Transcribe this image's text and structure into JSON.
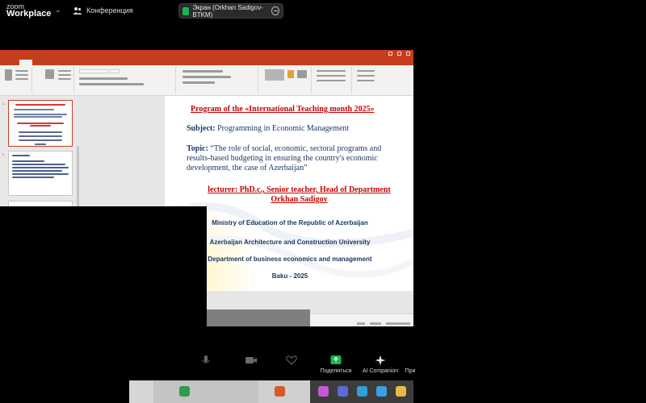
{
  "zoom": {
    "logo_line1": "zoom",
    "logo_line2": "Workplace",
    "conference_label": "Конференция",
    "share_label": "Экран (Orkhan Sadigov-BTKM)"
  },
  "slide": {
    "program": "Program of the «International Teaching month 2025»",
    "subject_label": "Subject:",
    "subject_value": "Programming in Economic Management",
    "topic_label": "Topic:",
    "topic_value": "“The role of social, economic, sectoral programs and results-based budgeting in ensuring the country's economic development, the case of Azerbaijan”",
    "lecturer_line1": "lecturer: PhD.c., Senior teacher, Head of Department",
    "lecturer_line2": "Orkhan Sadigov",
    "ministry": "Ministry of Education of the Republic of Azerbaijan",
    "university": "Azerbaijan Architecture and Construction University",
    "department": "Department of business economics and management",
    "place_year": "Baku  - 2025"
  },
  "thumbnails": [
    "1",
    "2"
  ],
  "toolbar": {
    "share_screen": "Поделиться",
    "ai_companion": "AI Companion",
    "more": "При"
  },
  "colors": {
    "ppt_accent": "#c43e1c",
    "slide_red": "#cc0000",
    "slide_blue": "#1f3864",
    "zoom_green": "#19b54f"
  }
}
